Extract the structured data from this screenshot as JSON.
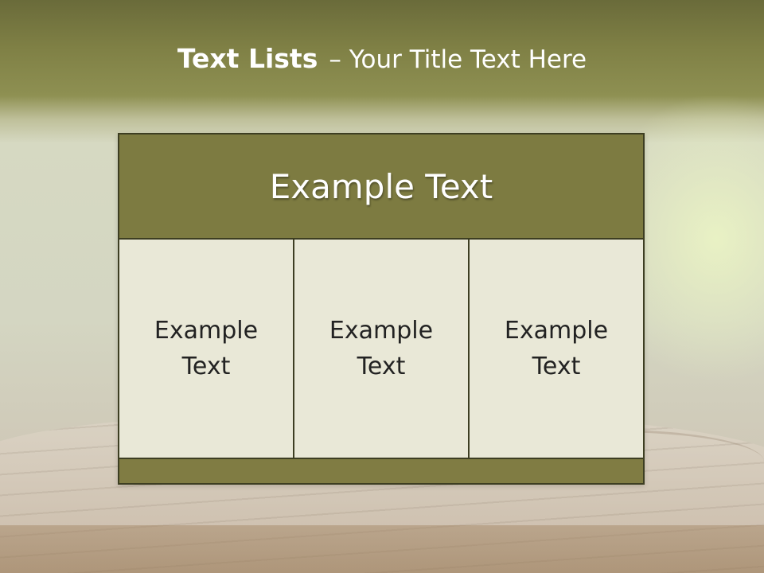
{
  "slide": {
    "title_bold": "Text Lists",
    "title_rest": "– Your Title Text Here"
  },
  "board": {
    "header": "Example Text",
    "cells": [
      {
        "line1": "Example",
        "line2": "Text"
      },
      {
        "line1": "Example",
        "line2": "Text"
      },
      {
        "line1": "Example",
        "line2": "Text"
      }
    ]
  },
  "colors": {
    "header_bg": "#7d7b41",
    "cell_bg": "#e9e8d7",
    "footer_bg": "#807c43",
    "border": "#3d3e22",
    "title_text": "#ffffff"
  }
}
